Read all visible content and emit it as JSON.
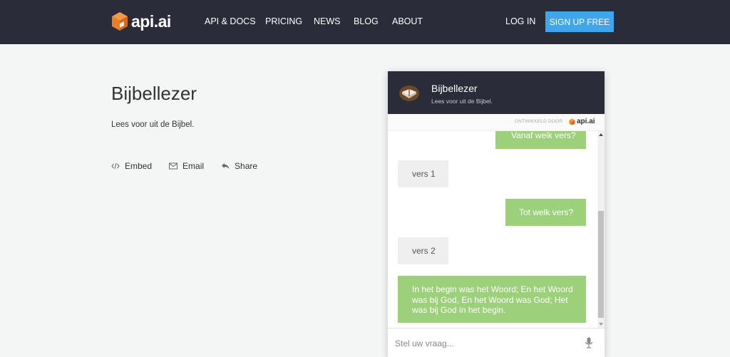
{
  "header": {
    "logo_text": "api.ai",
    "nav": [
      {
        "label": "API & DOCS",
        "name": "nav-api-docs"
      },
      {
        "label": "PRICING",
        "name": "nav-pricing"
      },
      {
        "label": "NEWS",
        "name": "nav-news"
      },
      {
        "label": "BLOG",
        "name": "nav-blog"
      },
      {
        "label": "ABOUT",
        "name": "nav-about"
      }
    ],
    "login_label": "LOG IN",
    "signup_label": "SIGN UP FREE"
  },
  "agent": {
    "title": "Bijbellezer",
    "description": "Lees voor uit de Bijbel.",
    "actions": {
      "embed": "Embed",
      "email": "Email",
      "share": "Share"
    }
  },
  "widget": {
    "title": "Bijbellezer",
    "subtitle": "Lees voor uit de Bijbel.",
    "powered_by": "ONTWIKKELD DOOR",
    "powered_logo": "api.ai",
    "messages": [
      {
        "from": "user",
        "text": "Vanaf welk vers?"
      },
      {
        "from": "bot",
        "text": "vers 1"
      },
      {
        "from": "user",
        "text": "Tot welk vers?"
      },
      {
        "from": "bot",
        "text": "vers 2"
      },
      {
        "from": "user",
        "text": "In het begin was het Woord; En het Woord was bij God, En het Woord was God; Het was bij God in het begin."
      }
    ],
    "input_placeholder": "Stel uw vraag..."
  },
  "colors": {
    "header_bg": "#2a2d39",
    "signup_bg": "#3fa6e7",
    "user_bubble": "#9cd07a",
    "bot_bubble": "#efefef",
    "logo_orange": "#ef7d22"
  },
  "icons": {
    "logo": "api-ai-cube-icon",
    "embed": "code-icon",
    "email": "envelope-icon",
    "share": "reply-arrow-icon",
    "mic": "microphone-icon",
    "avatar": "bible-book-icon"
  }
}
